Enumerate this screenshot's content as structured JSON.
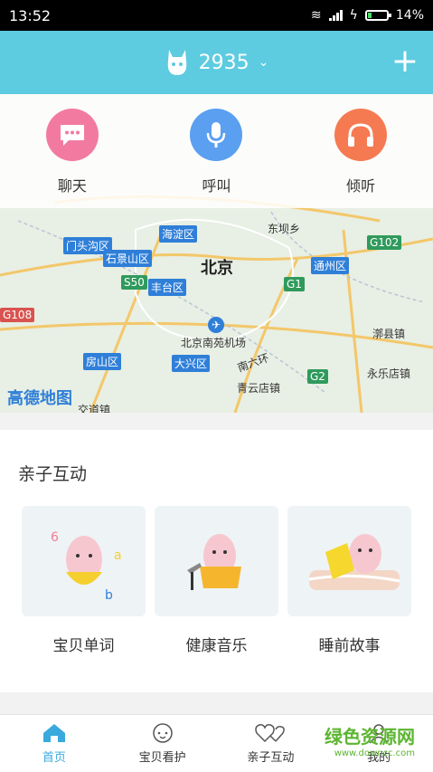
{
  "status_bar": {
    "time": "13:52",
    "battery": "14%"
  },
  "header": {
    "device_id": "2935"
  },
  "quick_actions": [
    {
      "label": "聊天",
      "icon": "chat-bubble-icon",
      "color": "#f27aa0"
    },
    {
      "label": "呼叫",
      "icon": "microphone-icon",
      "color": "#5a9ff0"
    },
    {
      "label": "倾听",
      "icon": "headphones-icon",
      "color": "#f57a52"
    }
  ],
  "map": {
    "city": "北京",
    "districts": [
      "门头沟区",
      "石景山区",
      "海淀区",
      "丰台区",
      "通州区",
      "房山区",
      "大兴区"
    ],
    "places": [
      "东坝乡",
      "北京南苑机场",
      "青云店镇",
      "漷县镇",
      "永乐店镇",
      "交道镇",
      "南六环"
    ],
    "roads": [
      "S50",
      "G1",
      "G2",
      "G102",
      "G108"
    ],
    "logo": "高德地图"
  },
  "section": {
    "title": "亲子互动",
    "cards": [
      {
        "label": "宝贝单词"
      },
      {
        "label": "健康音乐"
      },
      {
        "label": "睡前故事"
      }
    ]
  },
  "bottom_nav": [
    {
      "label": "首页"
    },
    {
      "label": "宝贝看护"
    },
    {
      "label": "亲子互动"
    },
    {
      "label": "我的"
    }
  ],
  "watermark": {
    "title": "绿色资源网",
    "url": "www.downcc.com"
  },
  "colors": {
    "header": "#5dcbe0",
    "accent": "#39a9de"
  }
}
